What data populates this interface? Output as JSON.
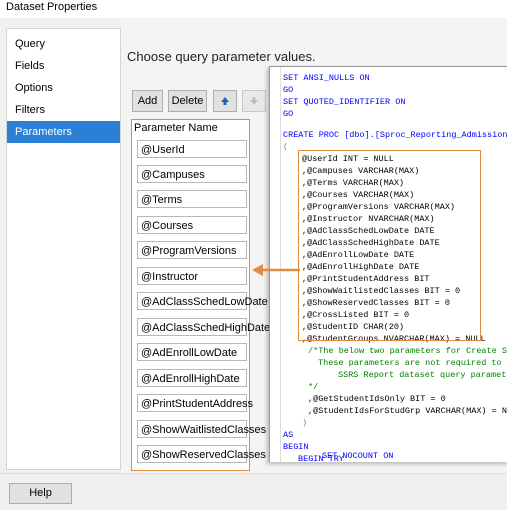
{
  "window": {
    "title": "Dataset Properties"
  },
  "sidebar": {
    "items": [
      {
        "label": "Query"
      },
      {
        "label": "Fields"
      },
      {
        "label": "Options"
      },
      {
        "label": "Filters"
      },
      {
        "label": "Parameters"
      }
    ]
  },
  "main": {
    "heading": "Choose query parameter values.",
    "toolbar": {
      "add_label": "Add",
      "delete_label": "Delete"
    },
    "grid": {
      "header": "Parameter Name",
      "rows": [
        "@UserId",
        "@Campuses",
        "@Terms",
        "@Courses",
        "@ProgramVersions",
        "@Instructor",
        "@AdClassSchedLowDate",
        "@AdClassSchedHighDate",
        "@AdEnrollLowDate",
        "@AdEnrollHighDate",
        "@PrintStudentAddress",
        "@ShowWaitlistedClasses",
        "@ShowReservedClasses"
      ]
    }
  },
  "code": {
    "line01": "SET ANSI_NULLS ON",
    "line02": "GO",
    "line03": "SET QUOTED_IDENTIFIER ON",
    "line04": "GO",
    "line05": "CREATE PROC [dbo].[Sproc_Reporting_Admissions_C",
    "line06": "(",
    "line07": "@UserId INT = NULL",
    "line08": ",@Campuses VARCHAR(MAX)",
    "line09": ",@Terms VARCHAR(MAX)",
    "line10": ",@Courses VARCHAR(MAX)",
    "line11": ",@ProgramVersions VARCHAR(MAX)",
    "line12": ",@Instructor NVARCHAR(MAX)",
    "line13": ",@AdClassSchedLowDate DATE",
    "line14": ",@AdClassSchedHighDate DATE",
    "line15": ",@AdEnrollLowDate DATE",
    "line16": ",@AdEnrollHighDate DATE",
    "line17": ",@PrintStudentAddress BIT",
    "line18": ",@ShowWaitlistedClasses BIT = 0",
    "line19": ",@ShowReservedClasses BIT = 0",
    "line20": ",@CrossListed BIT = 0",
    "line21": ",@StudentID CHAR(20)",
    "line22": ",@StudentGroups NVARCHAR(MAX) = NULL",
    "line23": "/*The below two parameters for Create Stud",
    "line24": "These parameters are not required to be",
    "line25": "SSRS Report dataset query parameter",
    "line26": "*/",
    "line27": ",@GetStudentIdsOnly BIT = 0",
    "line28": ",@StudentIdsForStudGrp VARCHAR(MAX) = NULL",
    "line29": ")",
    "line30": "AS",
    "line31": "BEGIN",
    "line32": "BEGIN TRY",
    "line33": "SET NOCOUNT ON"
  },
  "footer": {
    "help_label": "Help"
  },
  "colors": {
    "accent": "#2b7fd4",
    "annotation": "#e08b40",
    "keyword": "#0000ff",
    "function": "#ff00ff",
    "comment": "#008000"
  },
  "icons": {
    "move_up": "up-arrow-icon",
    "move_down": "down-arrow-icon",
    "pointer": "left-arrow-icon"
  }
}
